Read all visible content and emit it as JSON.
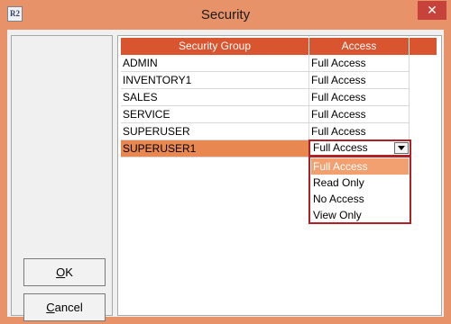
{
  "window": {
    "title": "Security",
    "icon_label": "R2",
    "close_glyph": "✕"
  },
  "buttons": {
    "ok": "OK",
    "ok_mnemonic": "O",
    "ok_rest": "K",
    "cancel_mnemonic": "C",
    "cancel_rest": "ancel"
  },
  "grid": {
    "headers": [
      "Security Group",
      "Access"
    ],
    "rows": [
      {
        "group": "ADMIN",
        "access": "Full Access"
      },
      {
        "group": "INVENTORY1",
        "access": "Full Access"
      },
      {
        "group": "SALES",
        "access": "Full Access"
      },
      {
        "group": "SERVICE",
        "access": "Full Access"
      },
      {
        "group": "SUPERUSER",
        "access": "Full Access"
      },
      {
        "group": "SUPERUSER1",
        "access": "Full Access"
      }
    ],
    "selected_row_index": 5
  },
  "access_combo": {
    "value": "Full Access",
    "options": [
      "Full Access",
      "Read Only",
      "No Access",
      "View Only"
    ],
    "highlighted_option_index": 0
  },
  "colors": {
    "frame": "#e8926a",
    "header": "#d9552f",
    "selected_row": "#e8874f",
    "highlight_option": "#f2a070",
    "focus_border": "#b02026"
  }
}
